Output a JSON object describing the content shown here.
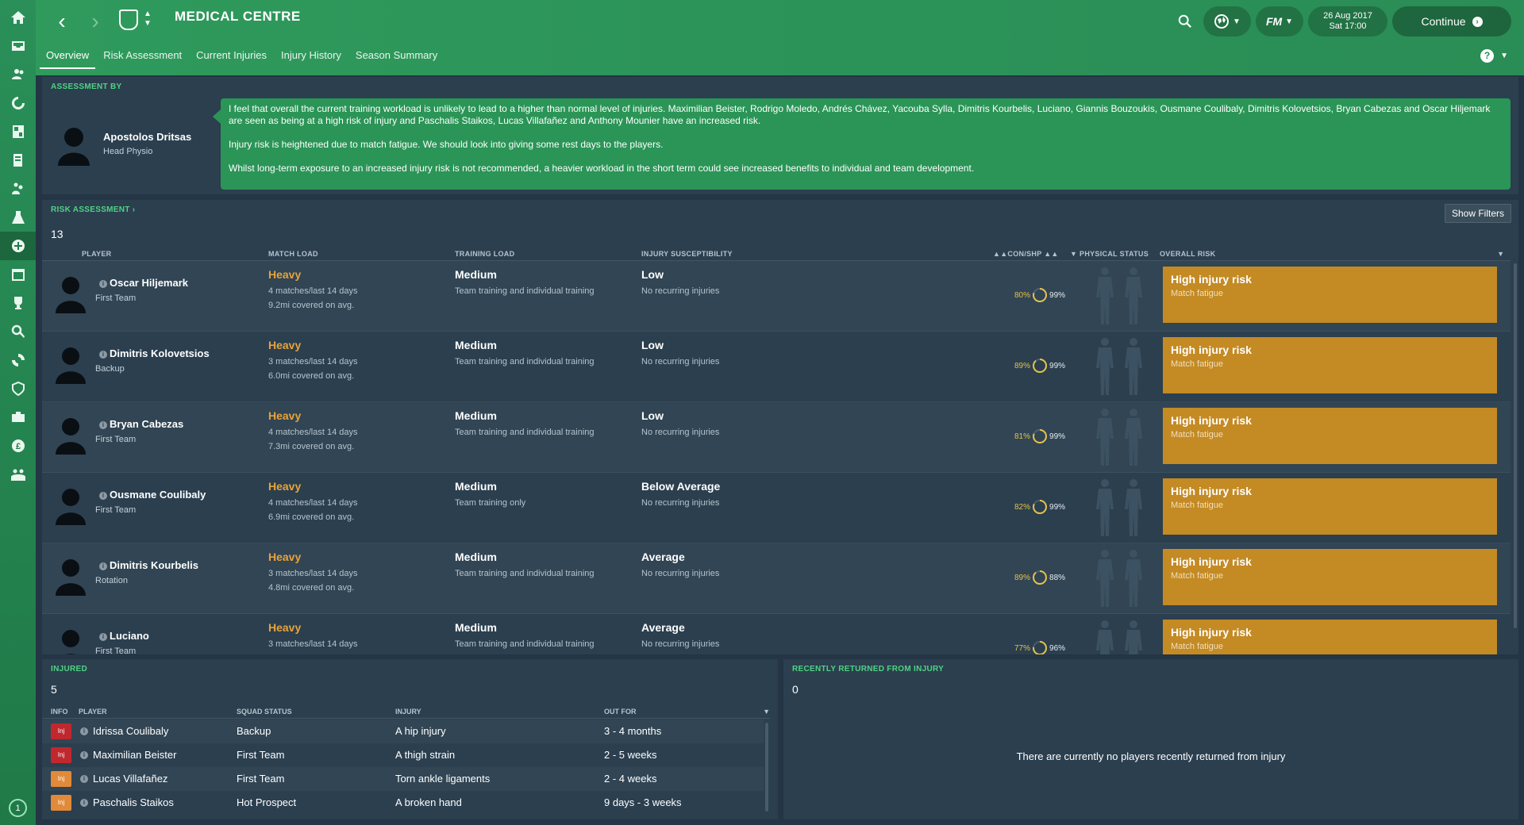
{
  "header": {
    "title": "MEDICAL CENTRE",
    "tabs": [
      "Overview",
      "Risk Assessment",
      "Current Injuries",
      "Injury History",
      "Season Summary"
    ],
    "date": "26 Aug 2017",
    "time": "Sat 17:00",
    "continue_label": "Continue",
    "fm_label": "FM",
    "help_label": "?"
  },
  "sidebar": {
    "icons": [
      "home-icon",
      "inbox-icon",
      "squad-icon",
      "tactics-icon",
      "team-report-icon",
      "staff-icon",
      "training-icon",
      "development-icon",
      "medical-icon",
      "schedule-icon",
      "competitions-icon",
      "scouting-icon",
      "transfers-icon",
      "club-vision-icon",
      "finances-icon",
      "dev-centre-icon",
      "community-icon"
    ],
    "bottom_badge": "1"
  },
  "assessment": {
    "label": "ASSESSMENT BY",
    "physio_name": "Apostolos Dritsas",
    "physio_role": "Head Physio",
    "paragraphs": [
      "I feel that overall the current training workload is unlikely to lead to a higher than normal level of injuries. Maximilian Beister, Rodrigo Moledo, Andrés Chávez, Yacouba Sylla, Dimitris Kourbelis, Luciano, Giannis Bouzoukis, Ousmane Coulibaly, Dimitris Kolovetsios, Bryan Cabezas and Oscar Hiljemark are seen as being at a high risk of injury and Paschalis Staikos, Lucas Villafañez and Anthony Mounier have an increased risk.",
      "Injury risk is heightened due to match fatigue. We should look into giving some rest days to the players.",
      "Whilst long-term exposure to an increased injury risk is not recommended, a heavier workload in the short term could see increased benefits to individual and team development."
    ]
  },
  "risk": {
    "label": "RISK ASSESSMENT",
    "label_arrow": "›",
    "count": "13",
    "show_filters": "Show Filters",
    "columns": {
      "player": "PLAYER",
      "match_load": "MATCH LOAD",
      "training_load": "TRAINING LOAD",
      "susceptibility": "INJURY SUSCEPTIBILITY",
      "con_shp": "CON/SHP",
      "physical_status": "PHYSICAL STATUS",
      "overall_risk": "OVERALL RISK"
    },
    "rows": [
      {
        "name": "Oscar Hiljemark",
        "status": "First Team",
        "match_load": "Heavy",
        "matches": "4 matches/last 14 days",
        "distance": "9.2mi covered on avg.",
        "training_load": "Medium",
        "training_detail": "Team training and individual training",
        "susceptibility": "Low",
        "recurring": "No recurring injuries",
        "con": "80%",
        "shp": "99%",
        "con_value": 80,
        "risk": "High injury risk",
        "risk_reason": "Match fatigue"
      },
      {
        "name": "Dimitris Kolovetsios",
        "status": "Backup",
        "match_load": "Heavy",
        "matches": "3 matches/last 14 days",
        "distance": "6.0mi covered on avg.",
        "training_load": "Medium",
        "training_detail": "Team training and individual training",
        "susceptibility": "Low",
        "recurring": "No recurring injuries",
        "con": "89%",
        "shp": "99%",
        "con_value": 89,
        "risk": "High injury risk",
        "risk_reason": "Match fatigue"
      },
      {
        "name": "Bryan Cabezas",
        "status": "First Team",
        "match_load": "Heavy",
        "matches": "4 matches/last 14 days",
        "distance": "7.3mi covered on avg.",
        "training_load": "Medium",
        "training_detail": "Team training and individual training",
        "susceptibility": "Low",
        "recurring": "No recurring injuries",
        "con": "81%",
        "shp": "99%",
        "con_value": 81,
        "risk": "High injury risk",
        "risk_reason": "Match fatigue"
      },
      {
        "name": "Ousmane Coulibaly",
        "status": "First Team",
        "match_load": "Heavy",
        "matches": "4 matches/last 14 days",
        "distance": "6.9mi covered on avg.",
        "training_load": "Medium",
        "training_detail": "Team training only",
        "susceptibility": "Below Average",
        "recurring": "No recurring injuries",
        "con": "82%",
        "shp": "99%",
        "con_value": 82,
        "risk": "High injury risk",
        "risk_reason": "Match fatigue"
      },
      {
        "name": "Dimitris Kourbelis",
        "status": "Rotation",
        "match_load": "Heavy",
        "matches": "3 matches/last 14 days",
        "distance": "4.8mi covered on avg.",
        "training_load": "Medium",
        "training_detail": "Team training and individual training",
        "susceptibility": "Average",
        "recurring": "No recurring injuries",
        "con": "89%",
        "shp": "88%",
        "con_value": 89,
        "risk": "High injury risk",
        "risk_reason": "Match fatigue"
      },
      {
        "name": "Luciano",
        "status": "First Team",
        "match_load": "Heavy",
        "matches": "3 matches/last 14 days",
        "distance": "",
        "training_load": "Medium",
        "training_detail": "Team training and individual training",
        "susceptibility": "Average",
        "recurring": "No recurring injuries",
        "con": "77%",
        "shp": "96%",
        "con_value": 77,
        "risk": "High injury risk",
        "risk_reason": "Match fatigue"
      }
    ]
  },
  "injured": {
    "label": "INJURED",
    "count": "5",
    "columns": {
      "info": "INFO",
      "player": "PLAYER",
      "squad_status": "SQUAD STATUS",
      "injury": "INJURY",
      "out_for": "OUT FOR"
    },
    "rows": [
      {
        "badge": "Inj",
        "badge_color": "#c0282d",
        "player": "Idrissa Coulibaly",
        "squad_status": "Backup",
        "injury": "A hip injury",
        "out_for": "3 - 4 months"
      },
      {
        "badge": "Inj",
        "badge_color": "#c0282d",
        "player": "Maximilian Beister",
        "squad_status": "First Team",
        "injury": "A thigh strain",
        "out_for": "2 - 5 weeks"
      },
      {
        "badge": "Inj",
        "badge_color": "#e08a3a",
        "player": "Lucas Villafañez",
        "squad_status": "First Team",
        "injury": "Torn ankle ligaments",
        "out_for": "2 - 4 weeks"
      },
      {
        "badge": "Inj",
        "badge_color": "#e08a3a",
        "player": "Paschalis Staikos",
        "squad_status": "Hot Prospect",
        "injury": "A broken hand",
        "out_for": "9 days - 3 weeks"
      }
    ]
  },
  "returned": {
    "label": "RECENTLY RETURNED FROM INJURY",
    "count": "0",
    "empty_message": "There are currently no players recently returned from injury"
  },
  "colors": {
    "accent": "#2a9556",
    "risk_high": "#c48a24",
    "heavy": "#e8a33a"
  }
}
